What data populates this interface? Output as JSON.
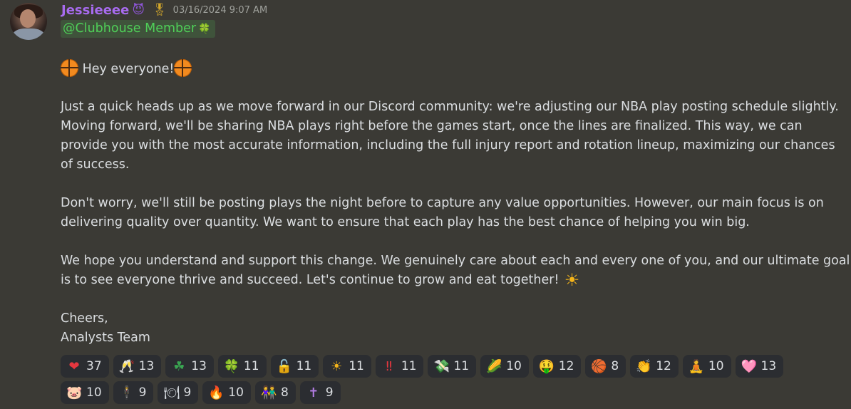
{
  "author": {
    "username": "Jessieeee",
    "name_emoji": "😈",
    "badge_emoji": "🎖",
    "timestamp": "03/16/2024 9:07 AM"
  },
  "mention": {
    "label": "@Clubhouse Member",
    "emoji": "🍀"
  },
  "body": {
    "greeting": "Hey everyone!",
    "paragraph1": [
      "Just a quick heads up as we move forward in our Discord community: we're adjusting our NBA play posting schedule slightly.",
      "Moving forward, we'll be sharing NBA plays right before the games start, once the lines are finalized. This way, we can",
      "provide you with the most accurate information, including the full injury report and rotation lineup, maximizing our chances",
      "of success."
    ],
    "paragraph2": [
      "Don't worry, we'll still be posting plays the night before to capture any value opportunities. However, our main focus is on",
      "delivering quality over quantity. We want to ensure that each play has the best chance of helping you win big."
    ],
    "paragraph3": [
      "We hope you understand and support this change. We genuinely care about each and every one of you, and our ultimate goal",
      "is to see everyone thrive and succeed. Let's continue to grow and eat together!"
    ],
    "closing": "Cheers,",
    "signature": "Analysts Team",
    "sun_emoji": "☀"
  },
  "reactions": {
    "row1": [
      {
        "emoji": "❤",
        "count": "37",
        "color": "#e5373f"
      },
      {
        "emoji": "🥂",
        "count": "13",
        "color": "#e8c25a"
      },
      {
        "emoji": "☘",
        "count": "13",
        "color": "#3aa552"
      },
      {
        "emoji": "🍀",
        "count": "11",
        "color": "#3aa552"
      },
      {
        "emoji": "🔓",
        "count": "11",
        "color": "#63b84b"
      },
      {
        "emoji": "☀",
        "count": "11",
        "color": "#f4b41a"
      },
      {
        "emoji": "‼",
        "count": "11",
        "color": "#e5373f"
      },
      {
        "emoji": "💸",
        "count": "11",
        "color": "#7cc26b"
      },
      {
        "emoji": "🌽",
        "count": "10",
        "color": "#e6b800"
      },
      {
        "emoji": "🤑",
        "count": "12",
        "color": "#f4b41a"
      },
      {
        "emoji": "🏀",
        "count": "8",
        "color": "#c8892f"
      },
      {
        "emoji": "👏",
        "count": "12",
        "color": "#e0c080"
      },
      {
        "emoji": "🧘",
        "count": "10",
        "color": "#6aa0c8"
      },
      {
        "emoji": "🩷",
        "count": "13",
        "color": "#f2a3c0"
      }
    ],
    "row2": [
      {
        "emoji": "🐷",
        "count": "10",
        "color": "#f59ec0"
      },
      {
        "emoji": "🕴",
        "count": "9",
        "color": "#9aa4b0"
      },
      {
        "emoji": "🍽",
        "count": "9",
        "color": "#d6dbe0"
      },
      {
        "emoji": "🔥",
        "count": "10",
        "color": "#f5811f"
      },
      {
        "emoji": "👫",
        "count": "8",
        "color": "#e9b44c"
      },
      {
        "emoji": "✝",
        "count": "9",
        "color": "#b07be0"
      }
    ]
  }
}
